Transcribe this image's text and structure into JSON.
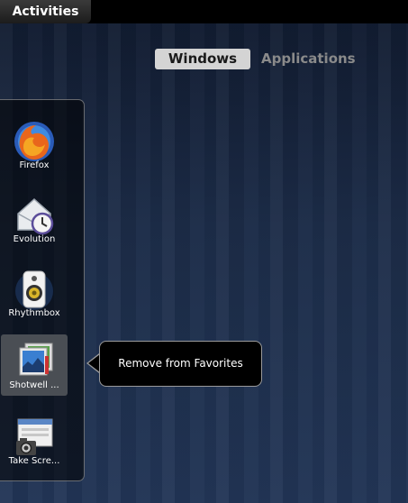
{
  "topbar": {
    "activities_label": "Activities"
  },
  "view_tabs": {
    "windows_label": "Windows",
    "applications_label": "Applications"
  },
  "dash": {
    "items": [
      {
        "label": "Firefox",
        "icon": "firefox-icon"
      },
      {
        "label": "Evolution",
        "icon": "evolution-icon"
      },
      {
        "label": "Rhythmbox",
        "icon": "rhythmbox-icon"
      },
      {
        "label": "Shotwell ...",
        "icon": "shotwell-icon",
        "selected": true
      },
      {
        "label": "Take Scre...",
        "icon": "screenshot-icon"
      }
    ]
  },
  "tooltip": {
    "text": "Remove from Favorites"
  },
  "colors": {
    "panel": "#000000",
    "active_tab_bg": "#d4d4d4",
    "inactive_tab_text": "#8a8a8a",
    "background": "#1c2c48"
  }
}
